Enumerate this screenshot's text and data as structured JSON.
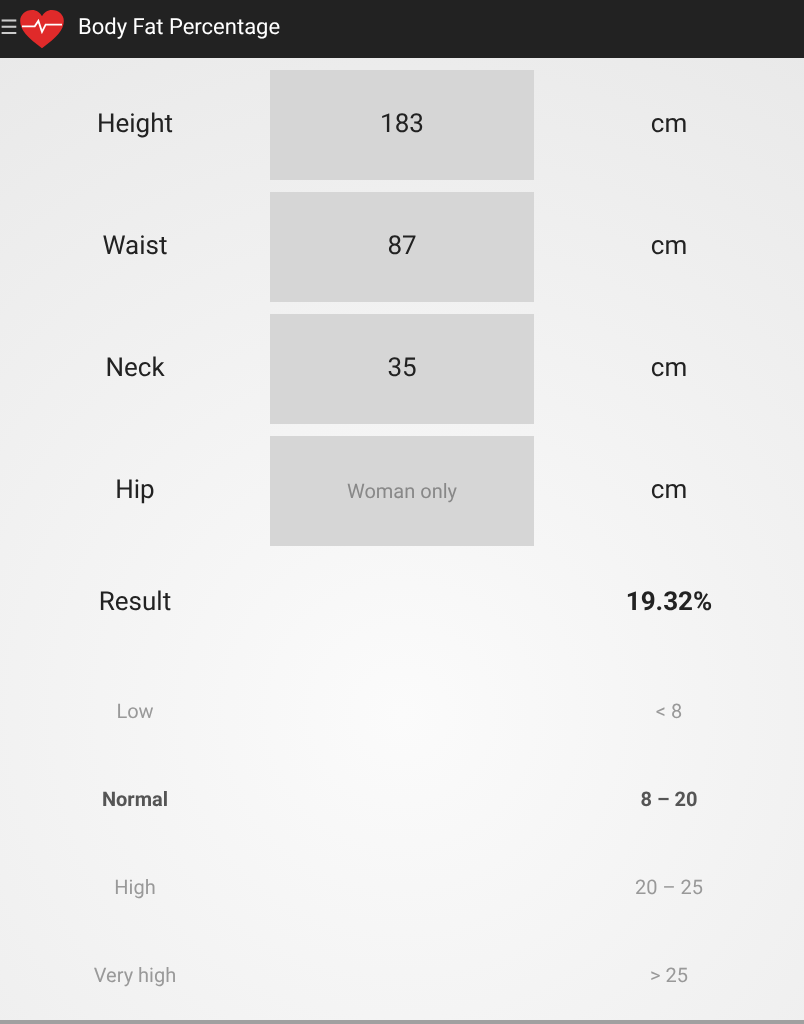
{
  "app_bar": {
    "menu_icon": "☰",
    "title": "Body Fat Percentage"
  },
  "inputs": [
    {
      "label": "Height",
      "value": "183",
      "unit": "cm"
    },
    {
      "label": "Waist",
      "value": "87",
      "unit": "cm"
    },
    {
      "label": "Neck",
      "value": "35",
      "unit": "cm"
    },
    {
      "label": "Hip",
      "placeholder": "Woman only",
      "unit": "cm"
    }
  ],
  "result": {
    "label": "Result",
    "value": "19.32%"
  },
  "categories": [
    {
      "label": "Low",
      "range": "< 8",
      "selected": false
    },
    {
      "label": "Normal",
      "range": "8 – 20",
      "selected": true
    },
    {
      "label": "High",
      "range": "20 – 25",
      "selected": false
    },
    {
      "label": "Very high",
      "range": "> 25",
      "selected": false
    }
  ]
}
